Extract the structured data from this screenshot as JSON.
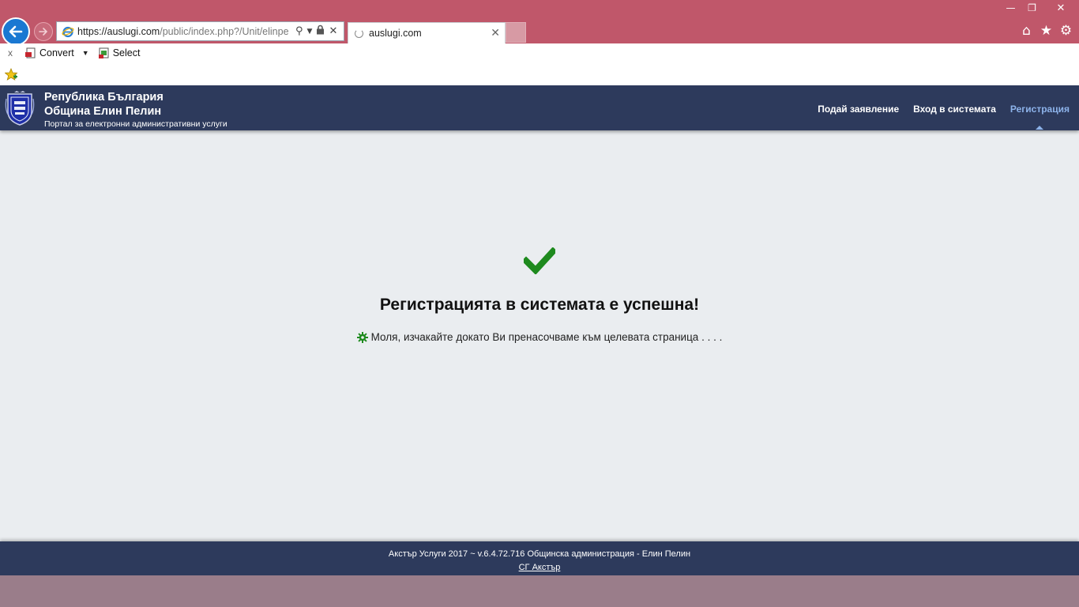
{
  "browser": {
    "url_main": "https://auslugi.com",
    "url_rest": "/public/index.php?/Unit/elinpe",
    "tab_title": "auslugi.com",
    "commands": {
      "close": "x",
      "convert_label": "Convert",
      "select_label": "Select"
    }
  },
  "header": {
    "line1": "Република България",
    "line2": "Община Елин Пелин",
    "line3": "Портал за електронни административни услуги",
    "nav": [
      {
        "label": "Подай заявление",
        "active": false
      },
      {
        "label": "Вход в системата",
        "active": false
      },
      {
        "label": "Регистрация",
        "active": true
      }
    ]
  },
  "main": {
    "heading": "Регистрацията в системата е успешна!",
    "message": "Моля, изчакайте докато Ви пренасочваме към целевата страница . . . ."
  },
  "footer": {
    "line1": "Акстър Услуги 2017 ~ v.6.4.72.716 Общинска администрация - Елин Пелин",
    "link": "СГ Акстър"
  },
  "colors": {
    "titlebar": "#c0576a",
    "header_bg": "#2d3a5c",
    "active_nav": "#8db3ea",
    "check_green": "#1e8a1e"
  }
}
